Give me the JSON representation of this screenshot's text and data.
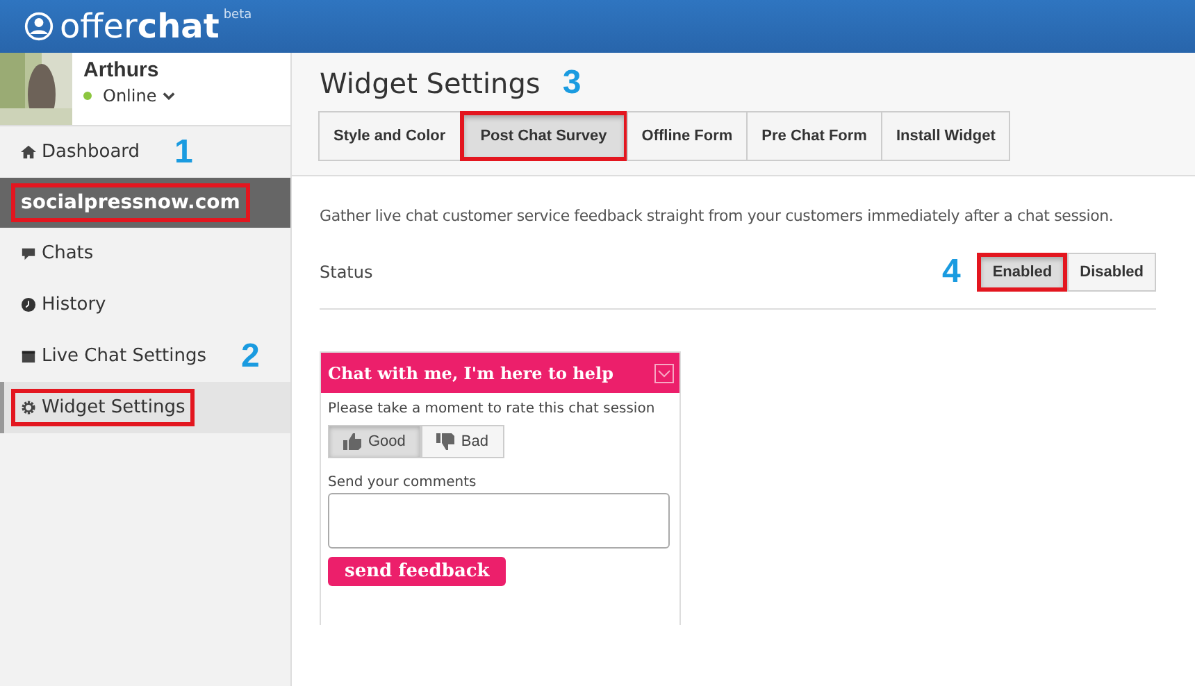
{
  "brand": {
    "name_light": "offer",
    "name_bold": "chat",
    "badge": "beta"
  },
  "user": {
    "name": "Arthurs",
    "status": "Online",
    "online": true
  },
  "sidebar": {
    "items": [
      {
        "kind": "nav",
        "label": "Dashboard",
        "selected": false,
        "boxed": false,
        "marker": "1"
      },
      {
        "kind": "site",
        "label": "socialpressnow.com",
        "selected": true,
        "boxed": true
      },
      {
        "kind": "nav",
        "label": "Chats",
        "selected": false,
        "boxed": false
      },
      {
        "kind": "nav",
        "label": "History",
        "selected": false,
        "boxed": false
      },
      {
        "kind": "nav",
        "label": "Live Chat Settings",
        "selected": false,
        "boxed": false,
        "marker": "2"
      },
      {
        "kind": "nav",
        "label": "Widget Settings",
        "selected": true,
        "boxed": true
      }
    ]
  },
  "page": {
    "title": "Widget Settings",
    "title_marker": "3",
    "tabs": [
      {
        "label": "Style and Color",
        "selected": false,
        "boxed": false
      },
      {
        "label": "Post Chat Survey",
        "selected": true,
        "boxed": true
      },
      {
        "label": "Offline Form",
        "selected": false,
        "boxed": false
      },
      {
        "label": "Pre Chat Form",
        "selected": false,
        "boxed": false
      },
      {
        "label": "Install Widget",
        "selected": false,
        "boxed": false
      }
    ],
    "description": "Gather live chat customer service feedback straight from your customers immediately after a chat session.",
    "status": {
      "label": "Status",
      "marker": "4",
      "options": [
        {
          "label": "Enabled",
          "selected": true,
          "boxed": true
        },
        {
          "label": "Disabled",
          "selected": false,
          "boxed": false
        }
      ]
    }
  },
  "widget": {
    "title": "Chat with me, I'm here to help",
    "prompt": "Please take a moment to rate this chat session",
    "ratings": [
      {
        "label": "Good",
        "selected": true
      },
      {
        "label": "Bad",
        "selected": false
      }
    ],
    "comments_label": "Send your comments",
    "button": "send feedback"
  }
}
